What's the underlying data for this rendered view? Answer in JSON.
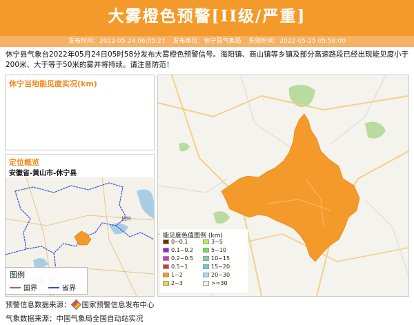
{
  "header": {
    "title": "大雾橙色预警[II级/严重]"
  },
  "meta": {
    "publish_time": "发布时间：2022-05-24 06:05:27",
    "publisher": "发布单位：休宁县气象局",
    "expire_time": "失效时间：2022-05-25 05:58:00"
  },
  "description": "休宁县气象台2022年05月24日05时58分发布大雾橙色预警信号。海阳镇、商山镇等乡镇及部分高速路段已经出现能见度小于200米、大于等于50米的雾并将持续。请注意防范！",
  "visibility_panel": {
    "title": "休宁当地能见度实况(km)"
  },
  "location_panel": {
    "title": "定位概览",
    "path": "安徽省-黄山市-休宁县",
    "city_label": "杭州",
    "town_label": "南昌"
  },
  "map_legend": {
    "title": "图例",
    "items": [
      {
        "label": "国界",
        "color": "#c0566a"
      },
      {
        "label": "省界",
        "color": "#2d4fd0"
      }
    ]
  },
  "visibility_legend": {
    "title": "能见度色值图例 (km)",
    "items": [
      {
        "label": "0~0.1",
        "color": "#7a2a00"
      },
      {
        "label": "0.1~0.2",
        "color": "#8a2be2"
      },
      {
        "label": "0.2~0.5",
        "color": "#d633c6"
      },
      {
        "label": "0.5~1",
        "color": "#e8322a"
      },
      {
        "label": "1~2",
        "color": "#f39a2b"
      },
      {
        "label": "2~3",
        "color": "#e6dc36"
      },
      {
        "label": "3~5",
        "color": "#b3ee52"
      },
      {
        "label": "5~10",
        "color": "#66e25a"
      },
      {
        "label": "10~15",
        "color": "#72d6a6"
      },
      {
        "label": "15~20",
        "color": "#68c8e8"
      },
      {
        "label": "20~30",
        "color": "#a9d7ee"
      },
      {
        "label": ">=30",
        "color": "#f2f2f2"
      }
    ]
  },
  "footer": {
    "warning_source_label": "预警信息数据来源：",
    "warning_source": "国家预警信息发布中心",
    "weather_source": "气象数据来源：中国气象局全国自动站实况"
  },
  "colors": {
    "header_bg": "#f39a2b",
    "accent": "#f08a1c",
    "warning_area": "#f39a2b"
  }
}
